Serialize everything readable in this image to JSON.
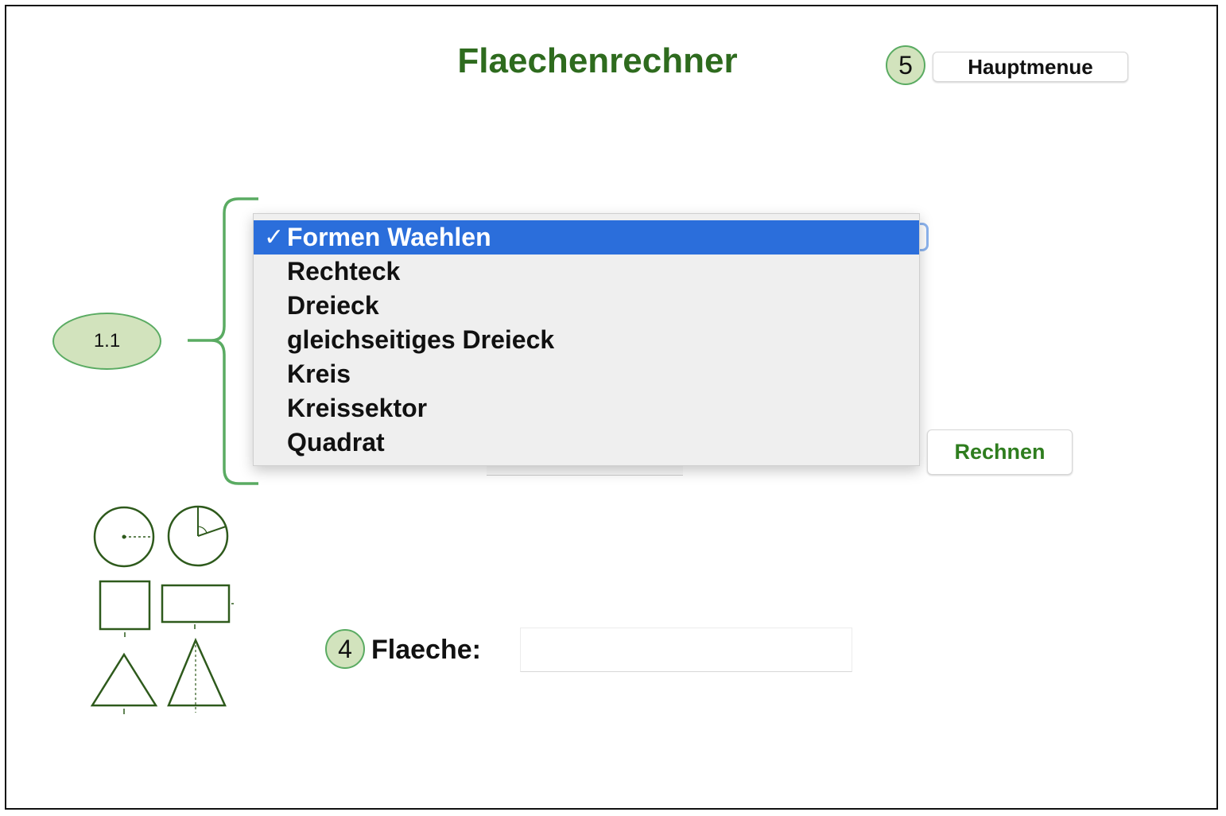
{
  "title": "Flaechenrechner",
  "header": {
    "badge_5": "5",
    "main_menu_label": "Hauptmenue"
  },
  "annotation": {
    "badge_1_1": "1.1"
  },
  "shape_select": {
    "options": [
      {
        "label": "Formen Waehlen",
        "selected": true
      },
      {
        "label": "Rechteck",
        "selected": false
      },
      {
        "label": "Dreieck",
        "selected": false
      },
      {
        "label": "gleichseitiges Dreieck",
        "selected": false
      },
      {
        "label": "Kreis",
        "selected": false
      },
      {
        "label": "Kreissektor",
        "selected": false
      },
      {
        "label": "Quadrat",
        "selected": false
      }
    ],
    "check_mark": "✓"
  },
  "calculate_label": "Rechnen",
  "result": {
    "badge_4": "4",
    "label": "Flaeche:",
    "value": ""
  },
  "colors": {
    "title": "#2e6b1e",
    "accent_green": "#5aab62",
    "badge_fill": "#d2e3bd",
    "selection_blue": "#2b6edb"
  },
  "icons": [
    "circle-radius-icon",
    "circle-sector-icon",
    "square-icon",
    "rectangle-icon",
    "equilateral-triangle-icon",
    "triangle-height-icon"
  ]
}
